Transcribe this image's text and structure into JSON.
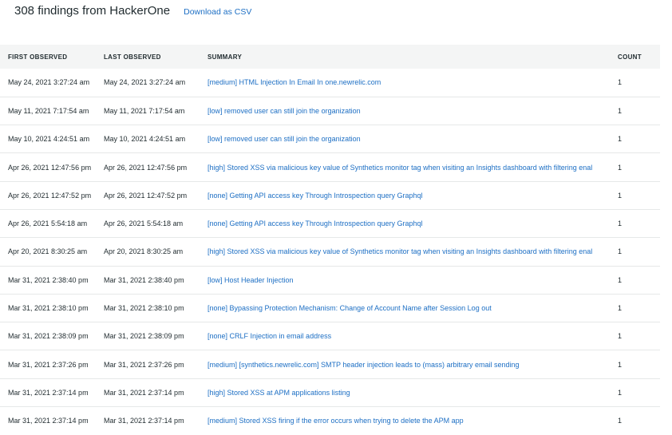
{
  "header": {
    "title": "308 findings from HackerOne",
    "download_label": "Download as CSV"
  },
  "columns": {
    "first_observed": "FIRST OBSERVED",
    "last_observed": "LAST OBSERVED",
    "summary": "SUMMARY",
    "count": "COUNT"
  },
  "rows": [
    {
      "first": "May 24, 2021 3:27:24 am",
      "last": "May 24, 2021 3:27:24 am",
      "summary": "[medium] HTML Injection In Email In one.newrelic.com",
      "count": "1"
    },
    {
      "first": "May 11, 2021 7:17:54 am",
      "last": "May 11, 2021 7:17:54 am",
      "summary": "[low] removed user can still join the organization",
      "count": "1"
    },
    {
      "first": "May 10, 2021 4:24:51 am",
      "last": "May 10, 2021 4:24:51 am",
      "summary": "[low] removed user can still join the organization",
      "count": "1"
    },
    {
      "first": "Apr 26, 2021 12:47:56 pm",
      "last": "Apr 26, 2021 12:47:56 pm",
      "summary": "[high] Stored XSS via malicious key value of Synthetics monitor tag when visiting an Insights dashboard with filtering enal",
      "count": "1"
    },
    {
      "first": "Apr 26, 2021 12:47:52 pm",
      "last": "Apr 26, 2021 12:47:52 pm",
      "summary": "[none] Getting API access key Through Introspection query Graphql",
      "count": "1"
    },
    {
      "first": "Apr 26, 2021 5:54:18 am",
      "last": "Apr 26, 2021 5:54:18 am",
      "summary": "[none] Getting API access key Through Introspection query Graphql",
      "count": "1"
    },
    {
      "first": "Apr 20, 2021 8:30:25 am",
      "last": "Apr 20, 2021 8:30:25 am",
      "summary": "[high] Stored XSS via malicious key value of Synthetics monitor tag when visiting an Insights dashboard with filtering enal",
      "count": "1"
    },
    {
      "first": "Mar 31, 2021 2:38:40 pm",
      "last": "Mar 31, 2021 2:38:40 pm",
      "summary": "[low] Host Header Injection",
      "count": "1"
    },
    {
      "first": "Mar 31, 2021 2:38:10 pm",
      "last": "Mar 31, 2021 2:38:10 pm",
      "summary": "[none] Bypassing Protection Mechanism: Change of Account Name after Session Log out",
      "count": "1"
    },
    {
      "first": "Mar 31, 2021 2:38:09 pm",
      "last": "Mar 31, 2021 2:38:09 pm",
      "summary": "[none] CRLF Injection in email address",
      "count": "1"
    },
    {
      "first": "Mar 31, 2021 2:37:26 pm",
      "last": "Mar 31, 2021 2:37:26 pm",
      "summary": "[medium] [synthetics.newrelic.com] SMTP header injection leads to (mass) arbitrary email sending",
      "count": "1"
    },
    {
      "first": "Mar 31, 2021 2:37:14 pm",
      "last": "Mar 31, 2021 2:37:14 pm",
      "summary": "[high] Stored XSS at APM applications listing",
      "count": "1"
    },
    {
      "first": "Mar 31, 2021 2:37:14 pm",
      "last": "Mar 31, 2021 2:37:14 pm",
      "summary": "[medium] Stored XSS firing if the error occurs when trying to delete the APM app",
      "count": "1"
    }
  ]
}
